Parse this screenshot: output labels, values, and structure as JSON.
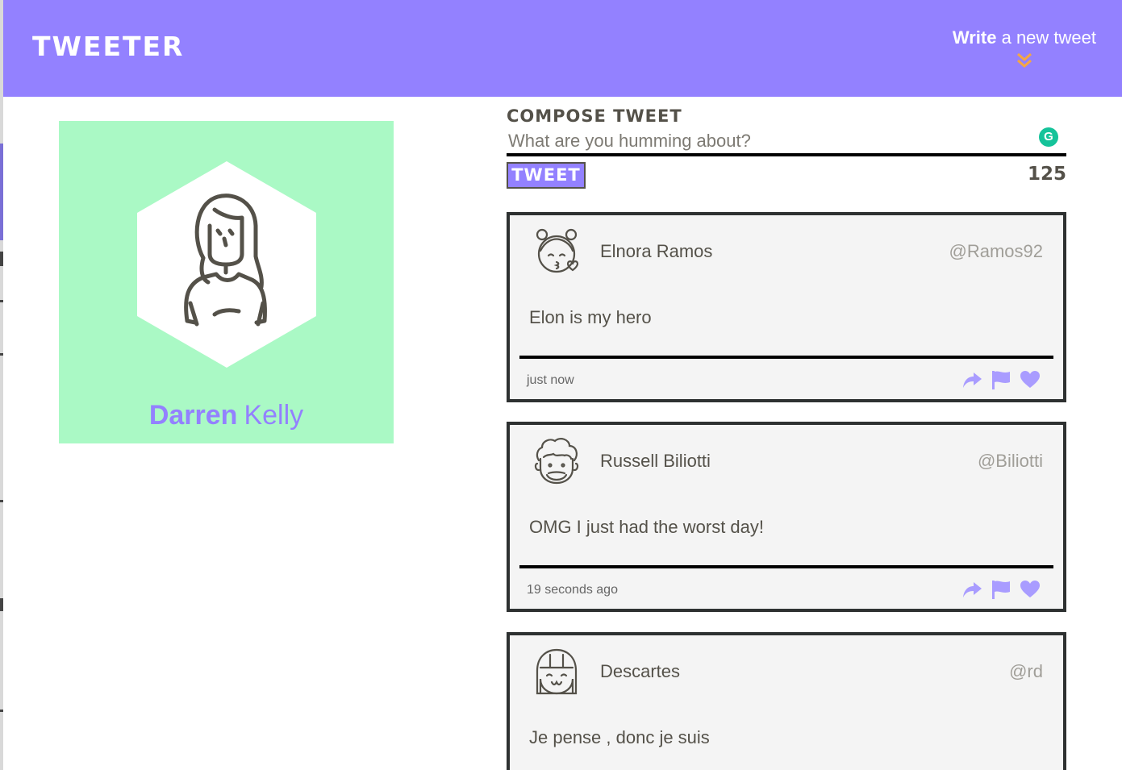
{
  "header": {
    "brand": "TWEETER",
    "compose_toggle": {
      "bold": "Write",
      "rest": "a new tweet"
    }
  },
  "profile": {
    "first_name": "Darren",
    "last_name": "Kelly"
  },
  "compose": {
    "title": "Compose Tweet",
    "placeholder": "What are you humming about?",
    "button_label": "TWEET",
    "counter": "125"
  },
  "tweets": [
    {
      "name": "Elnora Ramos",
      "handle": "@Ramos92",
      "content": "Elon is my hero",
      "time": "just now"
    },
    {
      "name": "Russell Biliotti",
      "handle": "@Biliotti",
      "content": "OMG I just had the worst day!",
      "time": "19 seconds ago"
    },
    {
      "name": "Descartes",
      "handle": "@rd",
      "content": "Je pense , donc je suis",
      "time": ""
    }
  ],
  "colors": {
    "accent": "#9381ff",
    "profile_bg": "#aaf9c5",
    "dark": "#545149",
    "chevron": "#f5a742"
  },
  "icons": {
    "retweet": "share-arrow-icon",
    "flag": "flag-icon",
    "like": "heart-icon"
  }
}
